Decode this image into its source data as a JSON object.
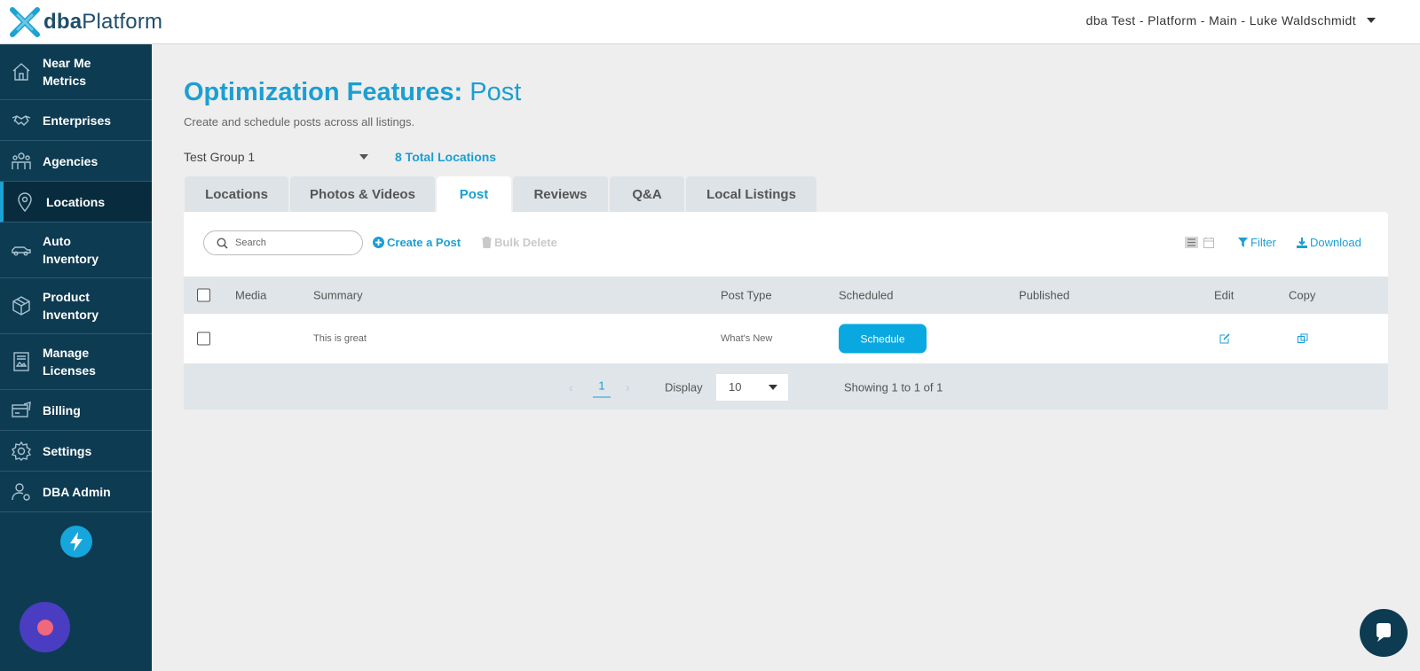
{
  "app": {
    "logo_bold": "dba",
    "logo_rest": "Platform",
    "account": "dba Test - Platform - Main - Luke Waldschmidt"
  },
  "sidebar": {
    "items": [
      {
        "label": "Near Me\nMetrics",
        "icon": "home-icon"
      },
      {
        "label": "Enterprises",
        "icon": "handshake-icon"
      },
      {
        "label": "Agencies",
        "icon": "people-icon"
      },
      {
        "label": "Locations",
        "icon": "map-pin-icon",
        "active": true
      },
      {
        "label": "Auto\nInventory",
        "icon": "car-icon"
      },
      {
        "label": "Product\nInventory",
        "icon": "box-icon"
      },
      {
        "label": "Manage\nLicenses",
        "icon": "license-icon"
      },
      {
        "label": "Billing",
        "icon": "billing-icon"
      },
      {
        "label": "Settings",
        "icon": "gear-icon"
      },
      {
        "label": "DBA Admin",
        "icon": "admin-user-icon"
      }
    ]
  },
  "page": {
    "title_bold": "Optimization Features:",
    "title_light": "Post",
    "subtitle": "Create and schedule posts across all listings.",
    "group": "Test Group 1",
    "total_locations": "8 Total Locations"
  },
  "tabs": [
    {
      "label": "Locations"
    },
    {
      "label": "Photos & Videos"
    },
    {
      "label": "Post",
      "active": true
    },
    {
      "label": "Reviews"
    },
    {
      "label": "Q&A"
    },
    {
      "label": "Local Listings"
    }
  ],
  "toolbar": {
    "search_placeholder": "Search",
    "create": "Create a Post",
    "bulk_delete": "Bulk Delete",
    "filter": "Filter",
    "download": "Download"
  },
  "table": {
    "headers": {
      "media": "Media",
      "summary": "Summary",
      "post_type": "Post Type",
      "scheduled": "Scheduled",
      "published": "Published",
      "edit": "Edit",
      "copy": "Copy"
    },
    "rows": [
      {
        "summary": "This is great",
        "post_type": "What's New",
        "scheduled_button": "Schedule",
        "published": ""
      }
    ]
  },
  "pagination": {
    "prev": "‹",
    "page": "1",
    "next": "›",
    "display_label": "Display",
    "display_value": "10",
    "showing": "Showing 1 to 1 of 1"
  },
  "colors": {
    "accent": "#1a9fd3",
    "sidebar": "#0d3b52",
    "schedule_button": "#09a8e0"
  }
}
